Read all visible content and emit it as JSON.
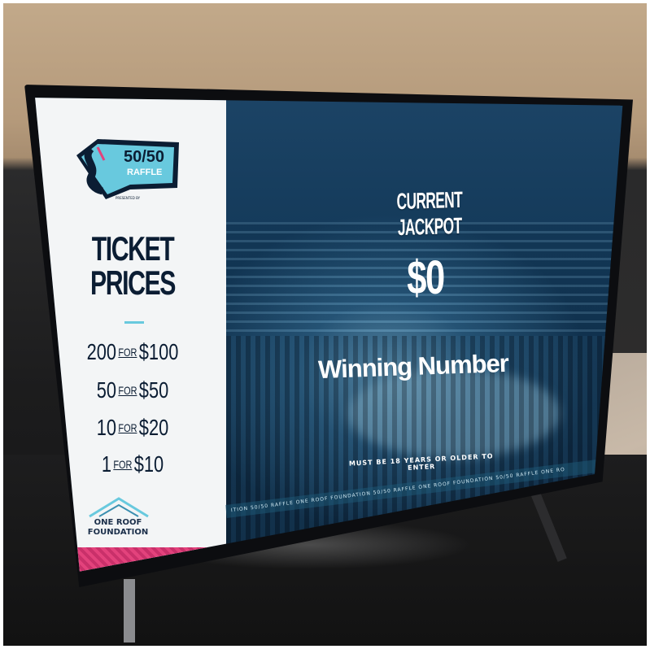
{
  "logo": {
    "line1": "50/50",
    "line2": "RAFFLE",
    "presented_by": "PRESENTED BY"
  },
  "prices": {
    "title_line1": "TICKET",
    "title_line2": "PRICES",
    "rows": [
      {
        "qty": "200",
        "for": "FOR",
        "price": "$100"
      },
      {
        "qty": "50",
        "for": "FOR",
        "price": "$50"
      },
      {
        "qty": "10",
        "for": "FOR",
        "price": "$20"
      },
      {
        "qty": "1",
        "for": "FOR",
        "price": "$10"
      }
    ]
  },
  "foundation": {
    "line1": "ONE ROOF",
    "line2": "FOUNDATION"
  },
  "jackpot": {
    "label": "CURRENT JACKPOT",
    "value": "$0"
  },
  "winning": {
    "label": "Winning Number"
  },
  "age_note": "MUST BE 18 YEARS OR OLDER TO ENTER",
  "ticker": "ITION 50/50 RAFFLE ONE ROOF FOUNDATION 50/50 RAFFLE ONE ROOF FOUNDATION 50/50 RAFFLE ONE RO",
  "colors": {
    "navy": "#0b1d33",
    "accent_blue": "#68c9de",
    "pink": "#e3427c",
    "arena_blue": "#143a5a"
  }
}
